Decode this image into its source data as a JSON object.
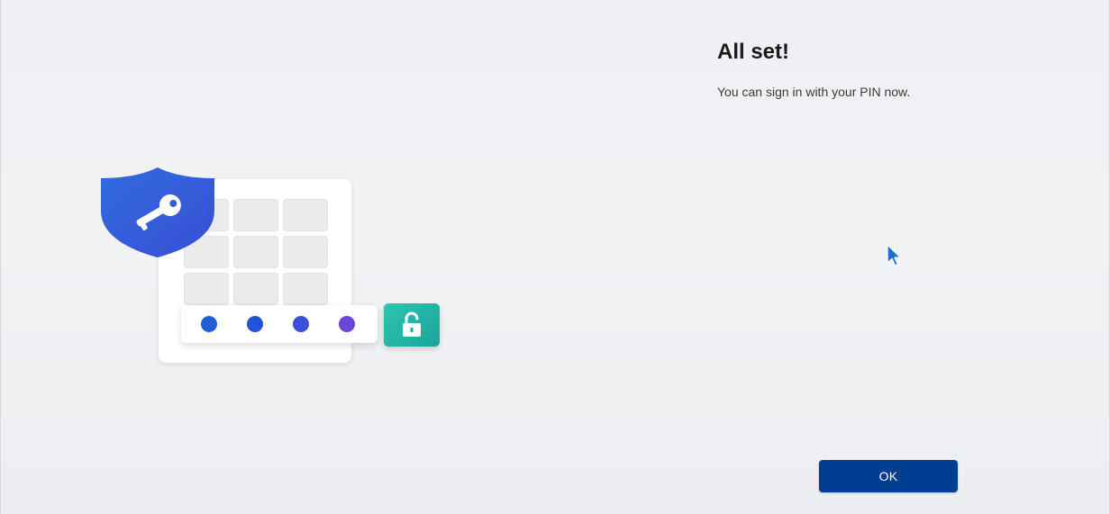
{
  "dialog": {
    "title": "All set!",
    "subtitle": "You can sign in with your PIN now.",
    "ok_label": "OK"
  },
  "illustration": {
    "pin_dot_colors": [
      "#1f5fd6",
      "#2553d8",
      "#3b4fd9",
      "#6a48d6"
    ],
    "shield_color": "#2b5fd9",
    "lock_tile_color": "#22b5a6",
    "icons": [
      "shield-key-icon",
      "unlock-icon"
    ]
  },
  "colors": {
    "accent": "#003e92",
    "background": "#eef0f3"
  }
}
